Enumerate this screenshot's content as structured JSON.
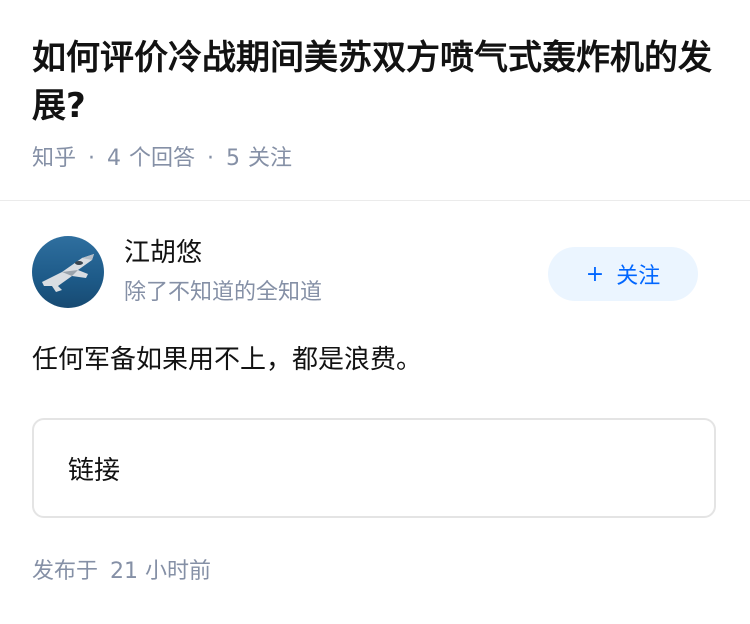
{
  "question": {
    "title": "如何评价冷战期间美苏双方喷气式轰炸机的发展?",
    "meta": {
      "source": "知乎",
      "answers_count": "4",
      "answers_label": "个回答",
      "followers_count": "5",
      "followers_label": "关注"
    }
  },
  "author": {
    "name": "江胡悠",
    "bio": "除了不知道的全知道",
    "avatar_icon": "fighter-jet-avatar",
    "follow_button": {
      "plus": "+",
      "label": "关注"
    }
  },
  "answer": {
    "text": "任何军备如果用不上，都是浪费。",
    "link_label": "链接",
    "posted_prefix": "发布于",
    "posted_time": "21 小时前"
  },
  "colors": {
    "primary_text": "#121212",
    "secondary_text": "#8590a6",
    "accent_blue": "#0066ff",
    "follow_bg": "#ebf5ff",
    "card_border": "#e4e4e4"
  }
}
